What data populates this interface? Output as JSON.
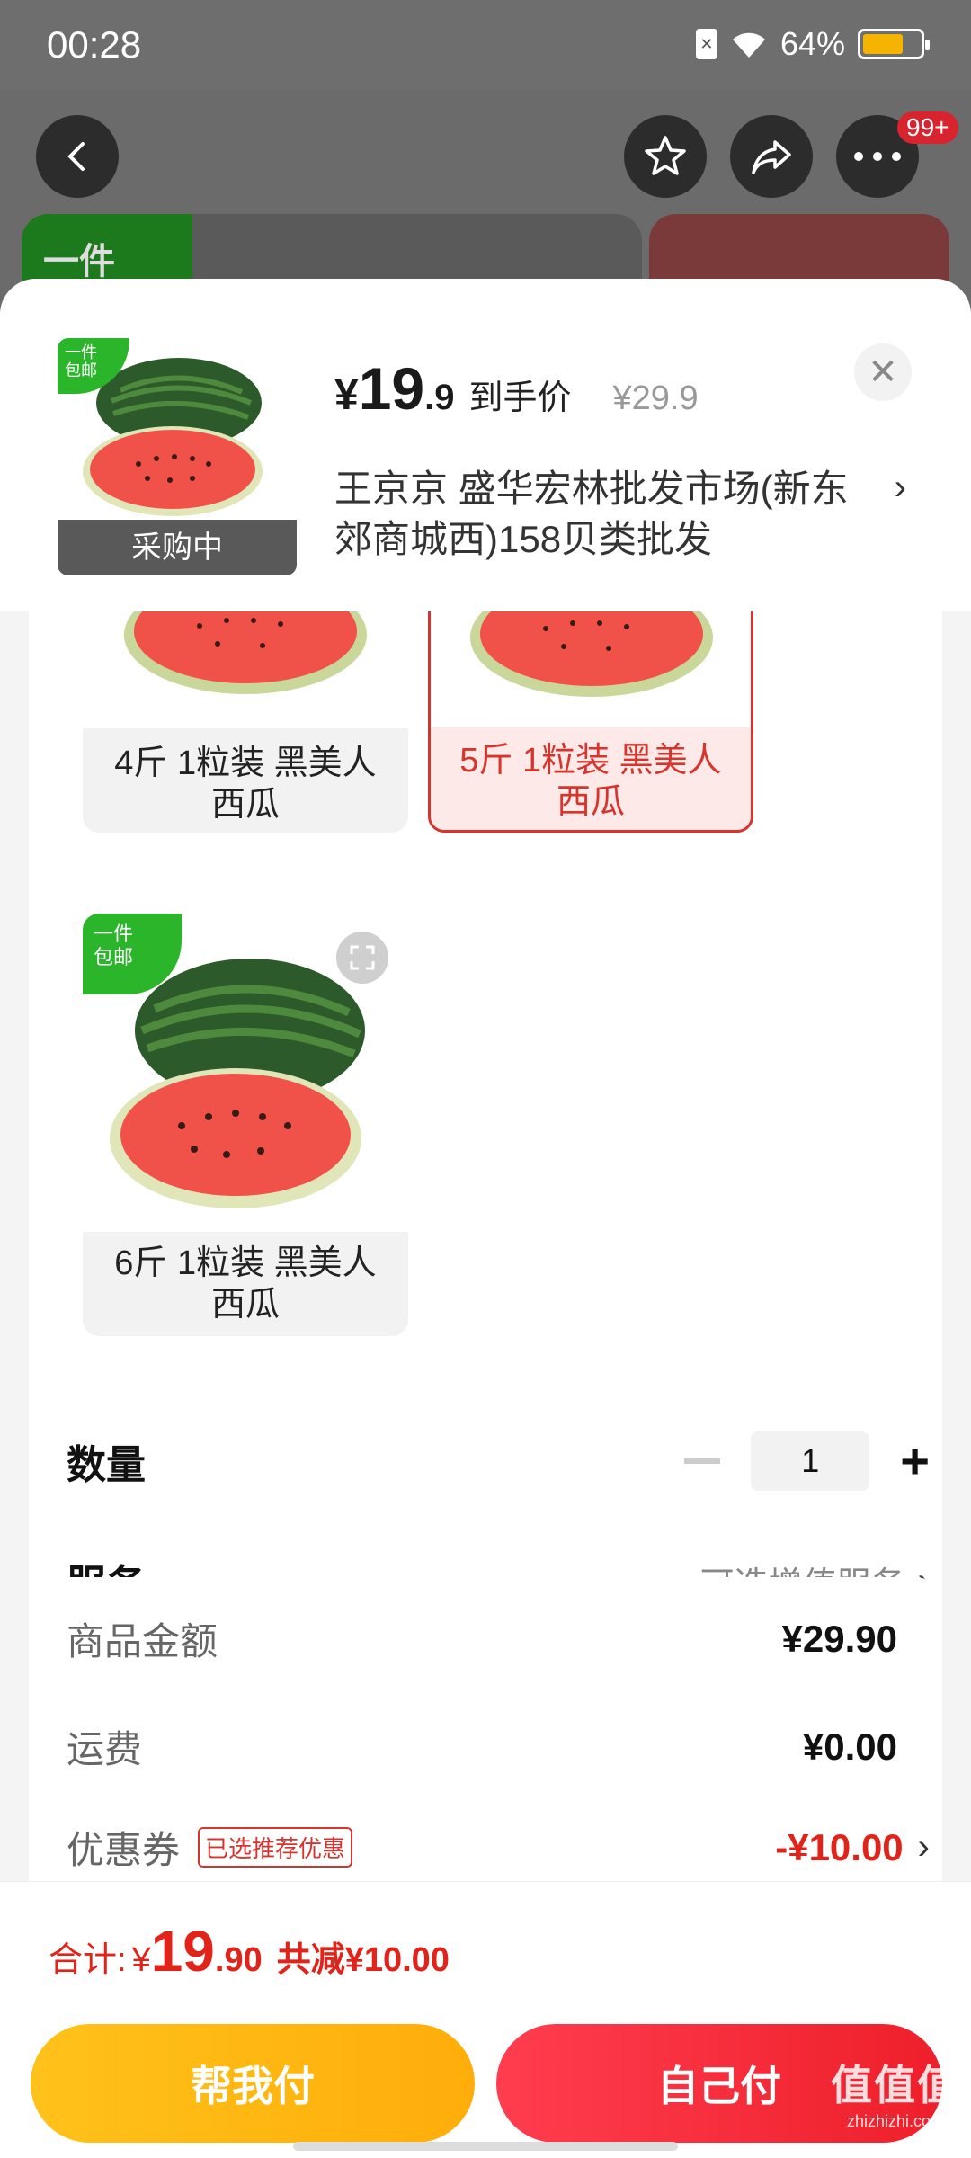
{
  "status_bar": {
    "time": "00:28",
    "battery": "64%",
    "battery_level": 0.64
  },
  "nav": {
    "badge": "99+"
  },
  "background_card": {
    "tag": "一件"
  },
  "product_header": {
    "thumb_tag_line1": "一件",
    "thumb_tag_line2": "包邮",
    "thumb_status": "采购中",
    "price_symbol": "¥",
    "price_int": "19",
    "price_dec": ".9",
    "price_label": "到手价",
    "price_original": "¥29.9",
    "seller": "王京京  盛华宏林批发市场(新东郊商城西)158贝类批发"
  },
  "options": [
    {
      "label": "4斤 1粒装 黑美人西瓜",
      "selected": false
    },
    {
      "label": "5斤 1粒装 黑美人西瓜",
      "selected": true
    },
    {
      "label": "6斤 1粒装 黑美人西瓜",
      "selected": false,
      "tag_line1": "一件",
      "tag_line2": "包邮"
    }
  ],
  "quantity": {
    "label": "数量",
    "value": "1"
  },
  "service": {
    "label": "服务",
    "value": "可选增值服务"
  },
  "fees": {
    "goods_label": "商品金额",
    "goods_value": "¥29.90",
    "shipping_label": "运费",
    "shipping_value": "¥0.00",
    "coupon_label": "优惠券",
    "coupon_tag": "已选推荐优惠",
    "coupon_value": "-¥10.00"
  },
  "total": {
    "label": "合计:",
    "yen": "¥",
    "int": "19",
    "dec": ".90",
    "saved": "共减¥10.00"
  },
  "buttons": {
    "help_pay": "帮我付",
    "self_pay": "自己付"
  },
  "watermark": {
    "main": "值值值",
    "sub": "zhizhizhi.com"
  }
}
